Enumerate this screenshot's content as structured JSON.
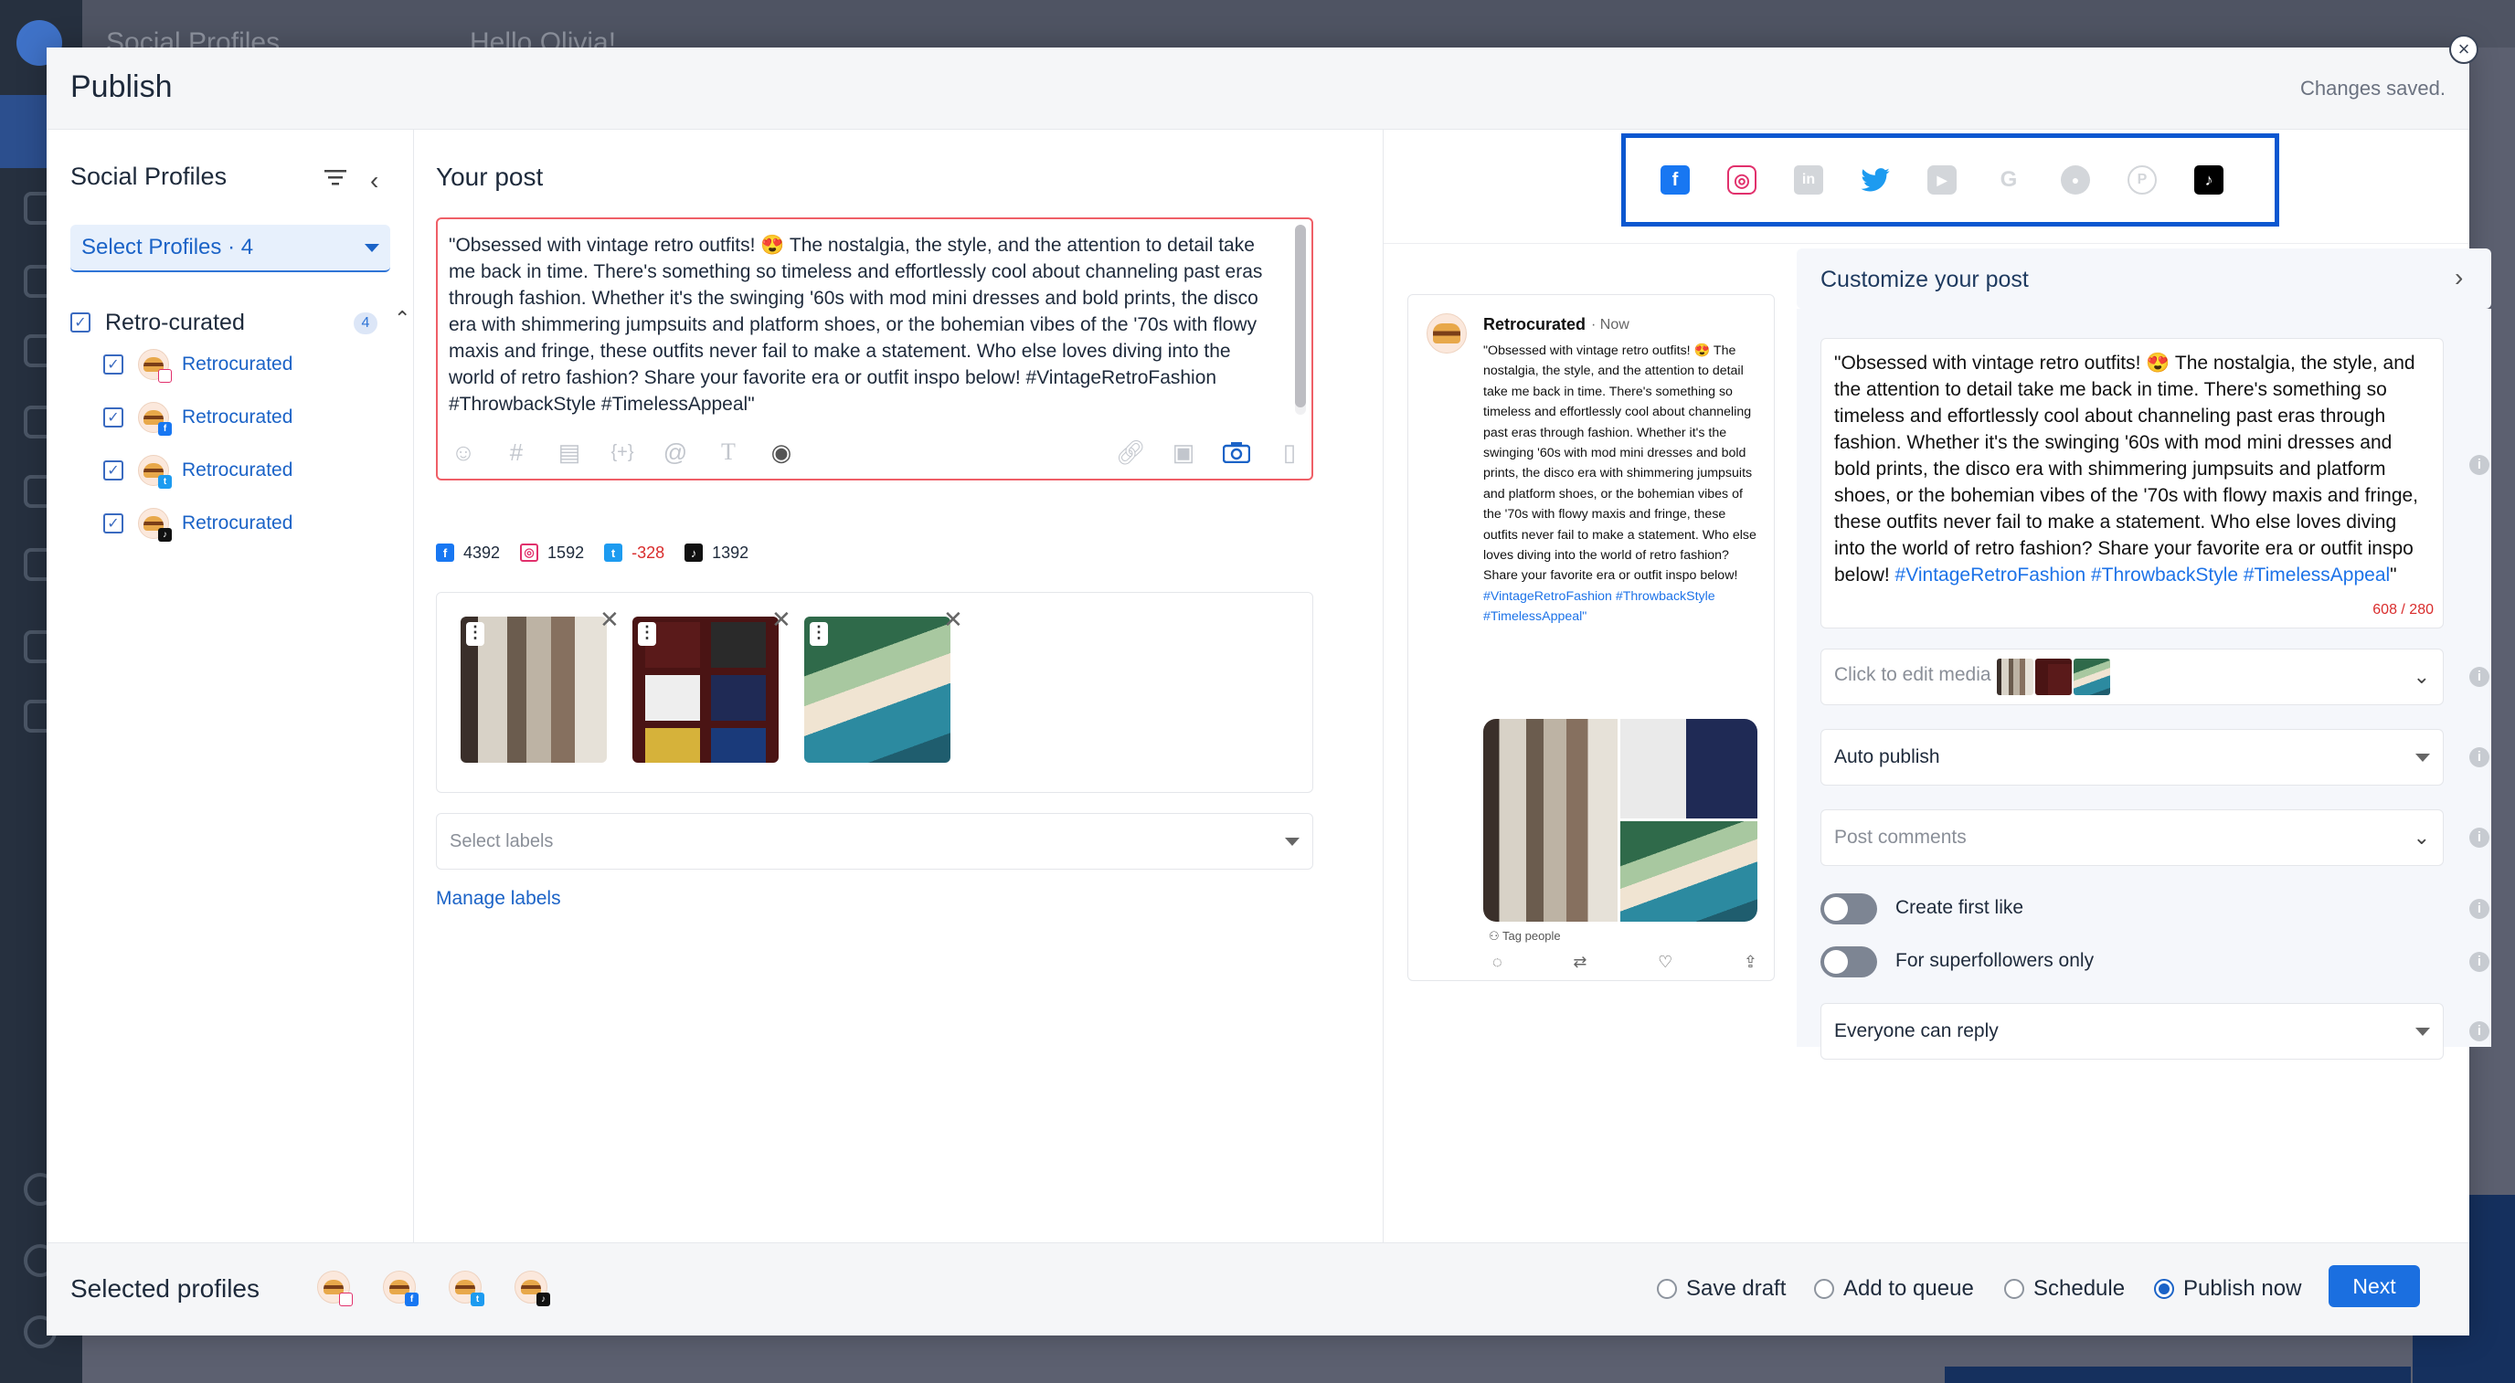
{
  "background": {
    "header_title": "Social Profiles",
    "greeting": "Hello Olivia!"
  },
  "modal": {
    "title": "Publish",
    "status": "Changes saved.",
    "close_glyph": "×"
  },
  "social_profiles": {
    "title": "Social Profiles",
    "select_label": "Select Profiles · 4",
    "group": {
      "name": "Retro-curated",
      "count": "4",
      "profiles": [
        {
          "name": "Retrocurated",
          "network": "instagram"
        },
        {
          "name": "Retrocurated",
          "network": "facebook"
        },
        {
          "name": "Retrocurated",
          "network": "twitter"
        },
        {
          "name": "Retrocurated",
          "network": "tiktok"
        }
      ]
    }
  },
  "post": {
    "title": "Your post",
    "text": "\"Obsessed with vintage retro outfits! 😍 The nostalgia, the style, and the attention to detail take me back in time. There's something so timeless and effortlessly cool about channeling past eras through fashion. Whether it's the swinging '60s with mod mini dresses and bold prints, the disco era with shimmering jumpsuits and platform shoes, or the bohemian vibes of the '70s with flowy maxis and fringe, these outfits never fail to make a statement. Who else loves diving into the world of retro fashion? Share your favorite era or outfit inspo below! #VintageRetroFashion #ThrowbackStyle #TimelessAppeal\"",
    "toolbar_icons": [
      "emoji-icon",
      "hashtag-icon",
      "snippet-icon",
      "variable-icon",
      "mention-icon",
      "text-format-icon",
      "ai-assistant-icon",
      "link-icon",
      "video-icon",
      "camera-icon",
      "document-icon"
    ],
    "char_counts": [
      {
        "network": "facebook",
        "value": "4392"
      },
      {
        "network": "instagram",
        "value": "1592"
      },
      {
        "network": "twitter",
        "value": "-328"
      },
      {
        "network": "tiktok",
        "value": "1392"
      }
    ],
    "media": [
      "clothing-rack-photo",
      "folded-tshirts-photo",
      "woman-on-car-photo"
    ],
    "labels_placeholder": "Select labels",
    "manage_labels": "Manage labels"
  },
  "network_tabs": [
    {
      "name": "facebook",
      "glyph": "f",
      "color": "#1877f2",
      "active": true
    },
    {
      "name": "instagram",
      "glyph": "◎",
      "color": "#e1306c",
      "active": true
    },
    {
      "name": "linkedin",
      "glyph": "in",
      "color": "#c9ccd1",
      "active": false
    },
    {
      "name": "twitter",
      "glyph": "🐦",
      "color": "#1d9bf0",
      "active": true
    },
    {
      "name": "youtube",
      "glyph": "▶",
      "color": "#c9ccd1",
      "active": false
    },
    {
      "name": "google",
      "glyph": "G",
      "color": "#d0d3d8",
      "active": false
    },
    {
      "name": "reddit",
      "glyph": "●",
      "color": "#c9ccd1",
      "active": false
    },
    {
      "name": "pinterest",
      "glyph": "P",
      "color": "#c9ccd1",
      "active": false
    },
    {
      "name": "tiktok",
      "glyph": "♪",
      "color": "#000000",
      "active": true
    }
  ],
  "preview": {
    "name": "Retrocurated",
    "time": "· Now",
    "text_body": "\"Obsessed with vintage retro outfits! 😍 The nostalgia, the style, and the attention to detail take me back in time. There's something so timeless and effortlessly cool about channeling past eras through fashion. Whether it's the swinging '60s with mod mini dresses and bold prints, the disco era with shimmering jumpsuits and platform shoes, or the bohemian vibes of the '70s with flowy maxis and fringe, these outfits never fail to make a statement. Who else loves diving into the world of retro fashion? Share your favorite era or outfit inspo below!",
    "hashtags": "#VintageRetroFashion #ThrowbackStyle #TimelessAppeal\"",
    "tag_people": "Tag people"
  },
  "customize": {
    "title": "Customize your post",
    "text_body": "\"Obsessed with vintage retro outfits! 😍 The nostalgia, the style, and the attention to detail take me back in time. There's something so timeless and effortlessly cool about channeling past eras through fashion. Whether it's the swinging '60s with mod mini dresses and bold prints, the disco era with shimmering jumpsuits and platform shoes, or the bohemian vibes of the '70s with flowy maxis and fringe, these outfits never fail to make a statement. Who else loves diving into the world of retro fashion? Share your favorite era or outfit inspo below!",
    "hashtags": "#VintageRetroFashion #ThrowbackStyle #TimelessAppeal",
    "closing_quote": "\"",
    "char_count": "608 / 280",
    "edit_media": "Click to edit media",
    "auto_publish": "Auto publish",
    "post_comments": "Post comments",
    "create_first_like": "Create first like",
    "superfollowers_only": "For superfollowers only",
    "reply_setting": "Everyone can reply"
  },
  "footer": {
    "selected_profiles": "Selected profiles",
    "options": [
      "Save draft",
      "Add to queue",
      "Schedule",
      "Publish now"
    ],
    "selected_option": "Publish now",
    "next": "Next"
  },
  "colors": {
    "accent": "#1b6fe0",
    "link": "#1b63c7",
    "error": "#d92d2d",
    "highlight_border": "#0b57d0"
  }
}
